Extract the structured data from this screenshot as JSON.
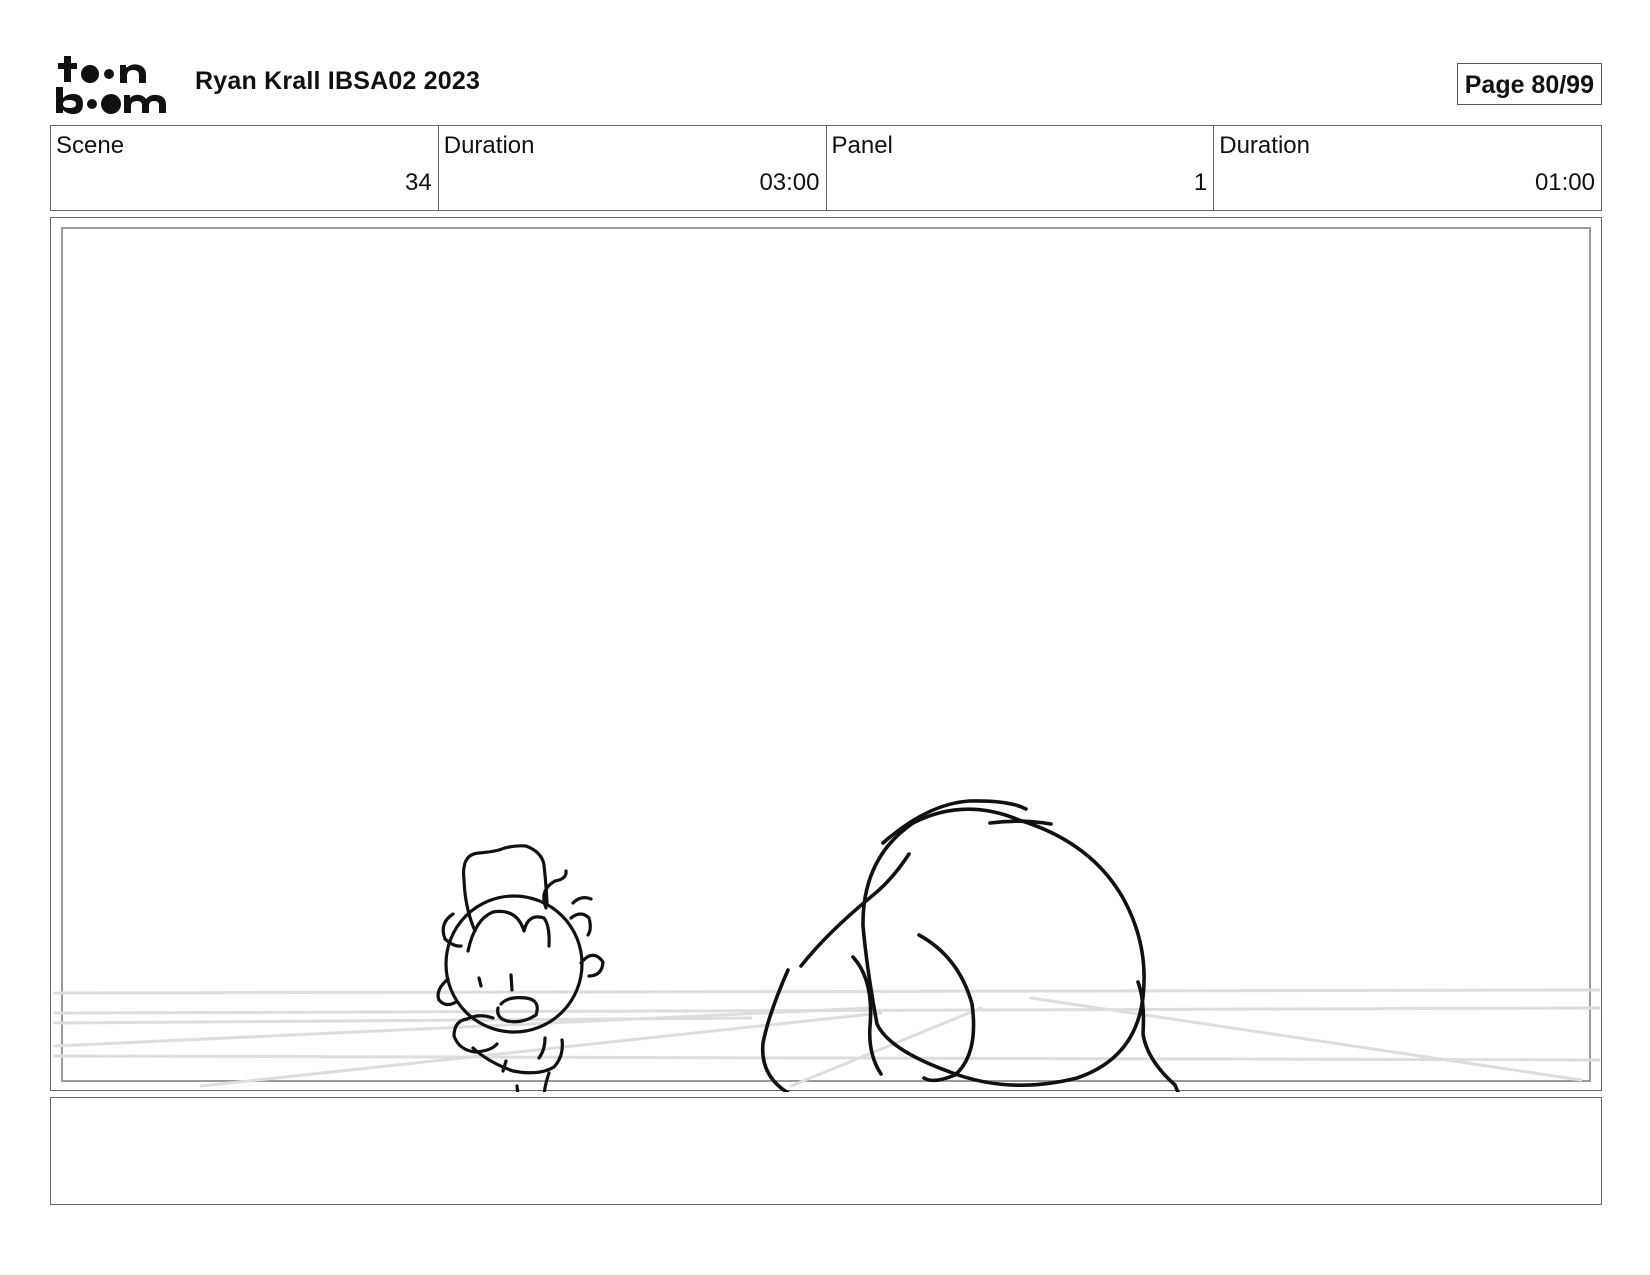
{
  "header": {
    "logo_text": "toon boom",
    "title": "Ryan Krall IBSA02 2023",
    "page": "Page 80/99"
  },
  "info": {
    "scene_label": "Scene",
    "scene_value": "34",
    "scene_duration_label": "Duration",
    "scene_duration_value": "03:00",
    "panel_label": "Panel",
    "panel_value": "1",
    "panel_duration_label": "Duration",
    "panel_duration_value": "01:00"
  },
  "notes": {
    "text": ""
  }
}
